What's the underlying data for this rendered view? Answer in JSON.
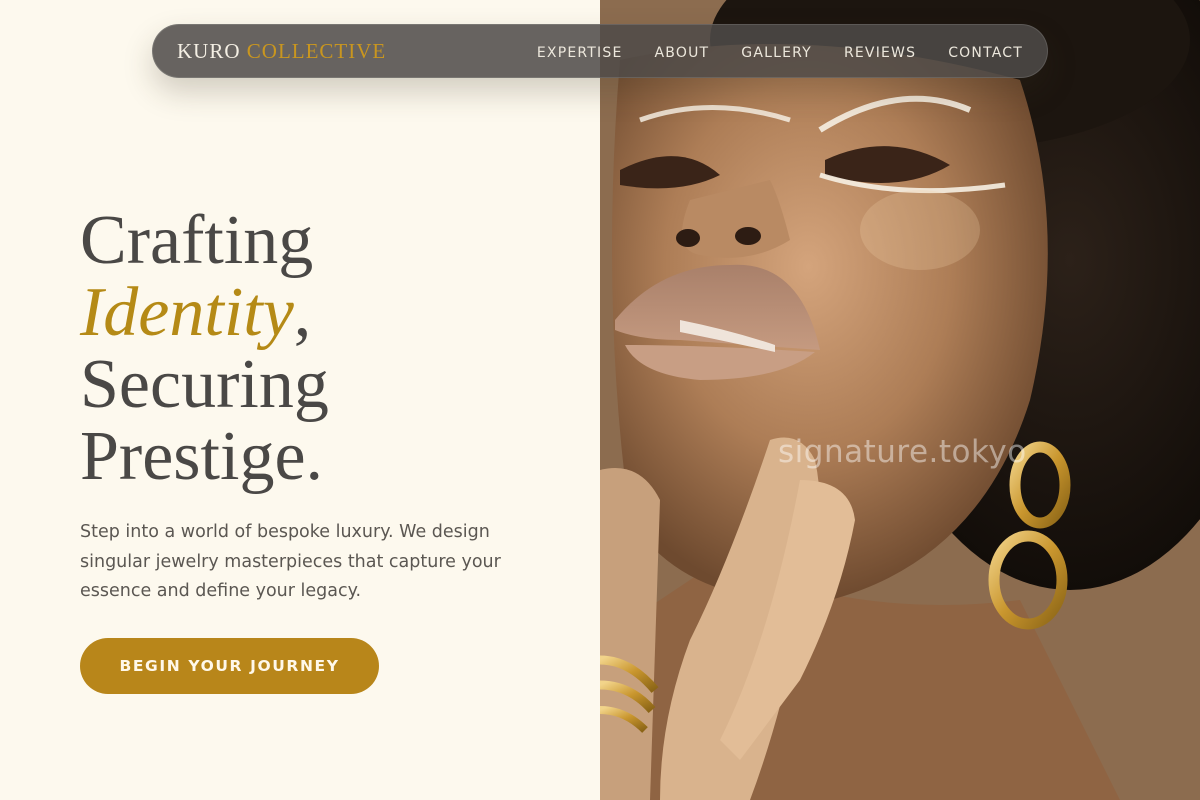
{
  "nav": {
    "brand_primary": "KURO",
    "brand_accent": "COLLECTIVE",
    "links": [
      "EXPERTISE",
      "ABOUT",
      "GALLERY",
      "REVIEWS",
      "CONTACT"
    ]
  },
  "hero": {
    "title_line1": "Crafting",
    "title_highlight": "Identity",
    "title_comma": ",",
    "title_line3": "Securing",
    "title_line4": "Prestige.",
    "subtitle": "Step into a world of bespoke luxury. We design singular jewelry masterpieces that capture your essence and define your legacy.",
    "cta_label": "BEGIN YOUR JOURNEY"
  },
  "photo": {
    "watermark": "signature.tokyo"
  },
  "colors": {
    "background": "#fdf9ee",
    "accent": "#b8861a",
    "heading": "#4a4846",
    "nav_bg": "#4e4b48"
  }
}
